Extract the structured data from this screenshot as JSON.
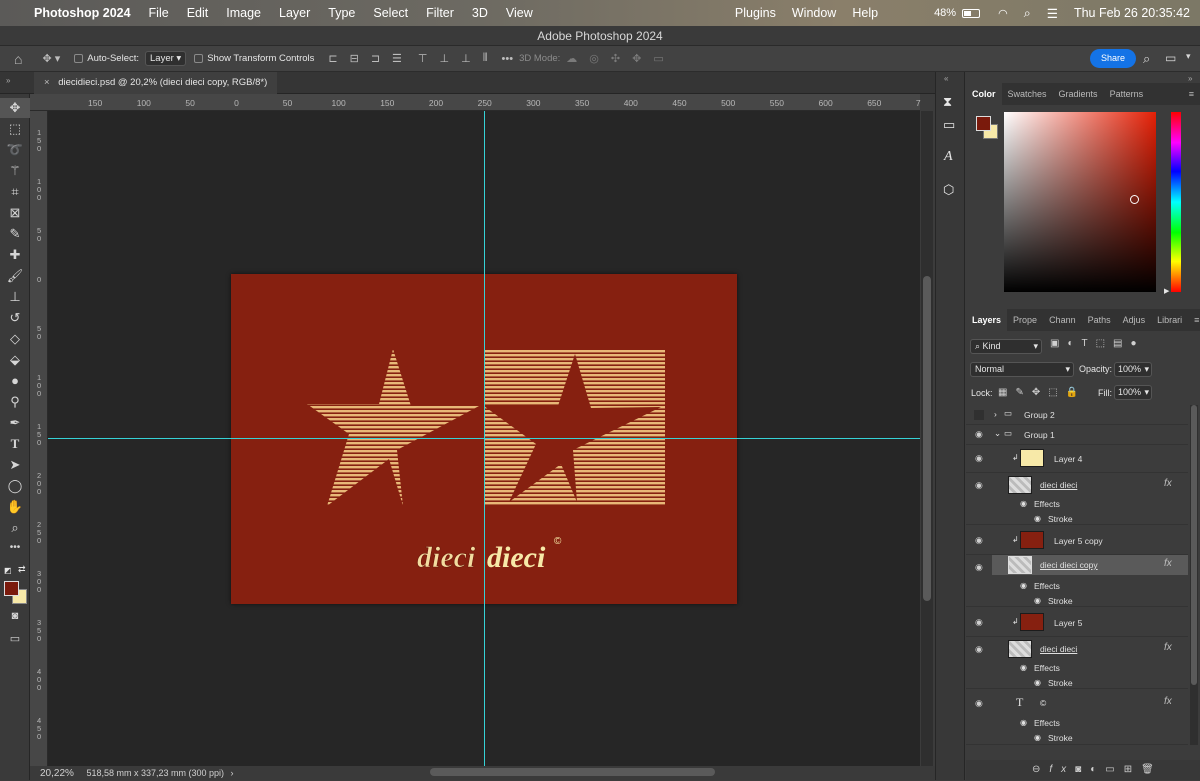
{
  "menubar": {
    "app_name": "Photoshop 2024",
    "items": [
      "File",
      "Edit",
      "Image",
      "Layer",
      "Type",
      "Select",
      "Filter",
      "3D",
      "View"
    ],
    "right_items": [
      "Plugins",
      "Window",
      "Help"
    ],
    "battery": "48%",
    "datetime": "Thu Feb 26  20:35:42"
  },
  "window": {
    "title": "Adobe Photoshop 2024"
  },
  "options": {
    "auto_select_label": "Auto-Select:",
    "auto_select_value": "Layer",
    "transform_label": "Show Transform Controls",
    "mode_3d_label": "3D Mode:",
    "share_label": "Share"
  },
  "document": {
    "tab_title": "diecidieci.psd @ 20,2% (dieci dieci copy, RGB/8*)",
    "logo_text_1": "dieci",
    "logo_text_2": "dieci",
    "copyright": "©",
    "zoom": "20,22%",
    "dimensions": "518,58 mm x 337,23 mm (300 ppi)"
  },
  "rulers": {
    "top_labels": [
      "150",
      "100",
      "50",
      "0",
      "50",
      "100",
      "150",
      "200",
      "250",
      "300",
      "350",
      "400",
      "450",
      "500",
      "550",
      "600",
      "650",
      "7"
    ],
    "left_labels": [
      "1 5 0",
      "1 0 0",
      "5 0",
      "0",
      "5 0",
      "1 0 0",
      "1 5 0",
      "2 0 0",
      "2 5 0",
      "3 0 0",
      "3 5 0",
      "4 0 0",
      "4 5 0"
    ]
  },
  "colors": {
    "foreground": "#7a1a0c",
    "background": "#f7e9a8",
    "accent": "#1473e6",
    "guide": "#36d2d6",
    "doc_bg": "#862010",
    "art": "#e8b878"
  },
  "color_panel": {
    "tabs": [
      "Color",
      "Swatches",
      "Gradients",
      "Patterns"
    ]
  },
  "layers_panel": {
    "tabs": [
      "Layers",
      "Prope",
      "Chann",
      "Paths",
      "Adjus",
      "Librari"
    ],
    "filter_kind": "Kind",
    "blend_mode": "Normal",
    "opacity_label": "Opacity:",
    "opacity_value": "100%",
    "lock_label": "Lock:",
    "fill_label": "Fill:",
    "fill_value": "100%",
    "layers": [
      {
        "name": "Group 2"
      },
      {
        "name": "Group 1"
      },
      {
        "name": "Layer 4"
      },
      {
        "name": "dieci dieci"
      },
      {
        "name": "Effects"
      },
      {
        "name": "Stroke"
      },
      {
        "name": "Layer 5 copy"
      },
      {
        "name": "dieci dieci copy"
      },
      {
        "name": "Effects"
      },
      {
        "name": "Stroke"
      },
      {
        "name": "Layer 5"
      },
      {
        "name": "dieci dieci"
      },
      {
        "name": "Effects"
      },
      {
        "name": "Stroke"
      },
      {
        "name": "©"
      },
      {
        "name": "Effects"
      },
      {
        "name": "Stroke"
      }
    ]
  }
}
